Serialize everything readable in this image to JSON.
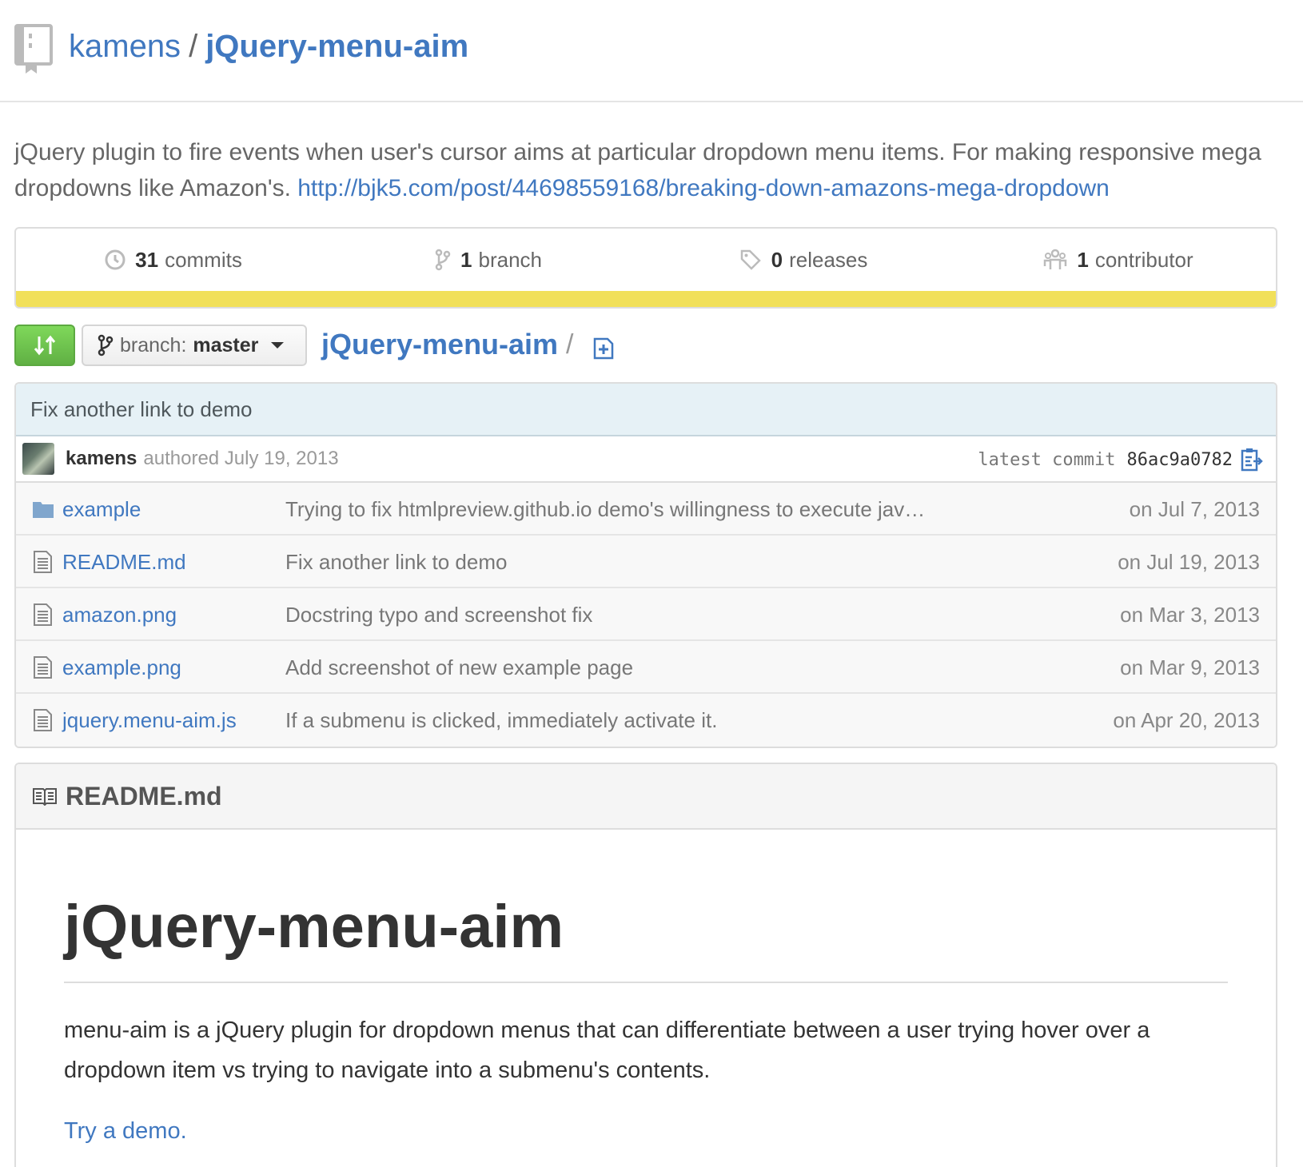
{
  "repo": {
    "owner": "kamens",
    "separator": "/",
    "name": "jQuery-menu-aim"
  },
  "description": {
    "text": "jQuery plugin to fire events when user's cursor aims at particular dropdown menu items. For making responsive mega dropdowns like Amazon's. ",
    "url": "http://bjk5.com/post/44698559168/breaking-down-amazons-mega-dropdown"
  },
  "summary": [
    {
      "count": "31",
      "label": "commits",
      "icon": "history-icon"
    },
    {
      "count": "1",
      "label": "branch",
      "icon": "branch-icon"
    },
    {
      "count": "0",
      "label": "releases",
      "icon": "tag-icon"
    },
    {
      "count": "1",
      "label": "contributor",
      "icon": "organization-icon"
    }
  ],
  "language_bar": {
    "color": "#f1e05a",
    "share": 1.0
  },
  "file_nav": {
    "branch_prefix": "branch:",
    "branch_name": "master",
    "breadcrumb": "jQuery-menu-aim",
    "breadcrumb_sep": "/"
  },
  "commit": {
    "message": "Fix another link to demo",
    "author": "kamens",
    "authored": "authored July 19, 2013",
    "latest_label": "latest commit",
    "sha": "86ac9a0782"
  },
  "files": [
    {
      "name": "example",
      "type": "dir",
      "message": "Trying to fix htmlpreview.github.io demo's willingness to execute jav…",
      "age": "on Jul 7, 2013"
    },
    {
      "name": "README.md",
      "type": "file",
      "message": "Fix another link to demo",
      "age": "on Jul 19, 2013"
    },
    {
      "name": "amazon.png",
      "type": "file",
      "message": "Docstring typo and screenshot fix",
      "age": "on Mar 3, 2013"
    },
    {
      "name": "example.png",
      "type": "file",
      "message": "Add screenshot of new example page",
      "age": "on Mar 9, 2013"
    },
    {
      "name": "jquery.menu-aim.js",
      "type": "file",
      "message": "If a submenu is clicked, immediately activate it.",
      "age": "on Apr 20, 2013"
    }
  ],
  "readme": {
    "header": "README.md",
    "title": "jQuery-menu-aim",
    "paragraph": "menu-aim is a jQuery plugin for dropdown menus that can differentiate between a user trying hover over a dropdown item vs trying to navigate into a submenu's contents.",
    "link": "Try a demo."
  },
  "colors": {
    "link": "#4078c0",
    "compare_button": "#6cc644",
    "commit_bar_bg": "#e6f1f6"
  }
}
